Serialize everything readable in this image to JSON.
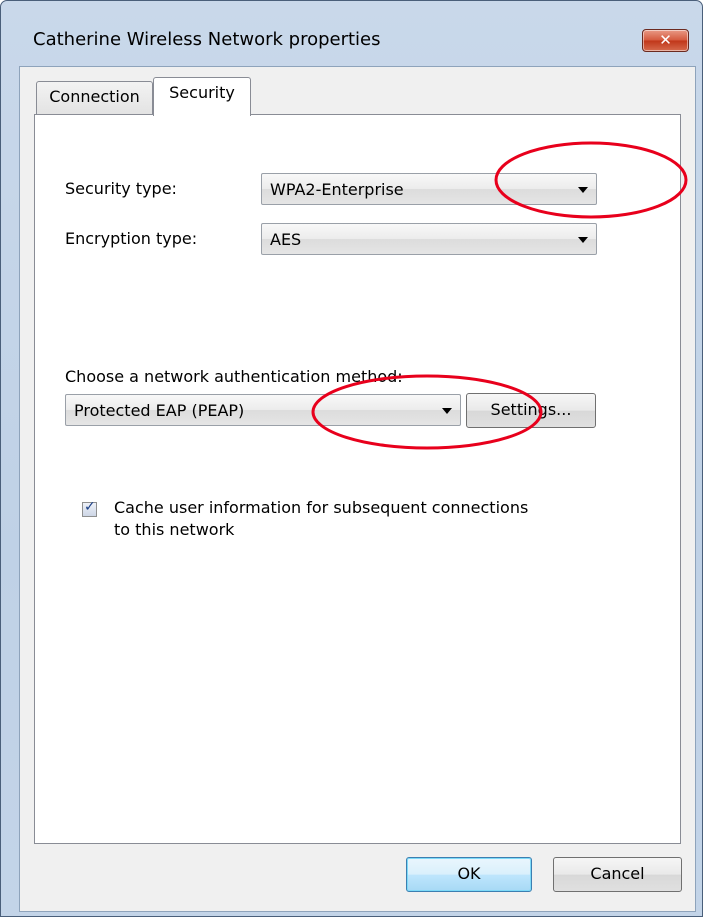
{
  "window": {
    "title": "Catherine Wireless Network properties",
    "close_symbol": "✕"
  },
  "tabs": [
    {
      "label": "Connection",
      "selected": false
    },
    {
      "label": "Security",
      "selected": true
    }
  ],
  "security": {
    "security_type_label": "Security type:",
    "security_type_value": "WPA2-Enterprise",
    "encryption_type_label": "Encryption type:",
    "encryption_type_value": "AES",
    "auth_method_label": "Choose a network authentication method:",
    "auth_method_value": "Protected EAP (PEAP)",
    "settings_label": "Settings...",
    "cache_label_line1": "Cache user information for subsequent connections",
    "cache_label_line2": "to this network",
    "cache_checked": true
  },
  "buttons": {
    "ok_label": "OK",
    "cancel_label": "Cancel"
  },
  "colors": {
    "annotation": "#e8001c",
    "window_frame": "#c3d4e8",
    "close_button": "#c7442a"
  },
  "icons": {
    "dropdown_arrow": "chevron-down-icon",
    "close": "close-icon",
    "check": "checkmark-icon"
  }
}
